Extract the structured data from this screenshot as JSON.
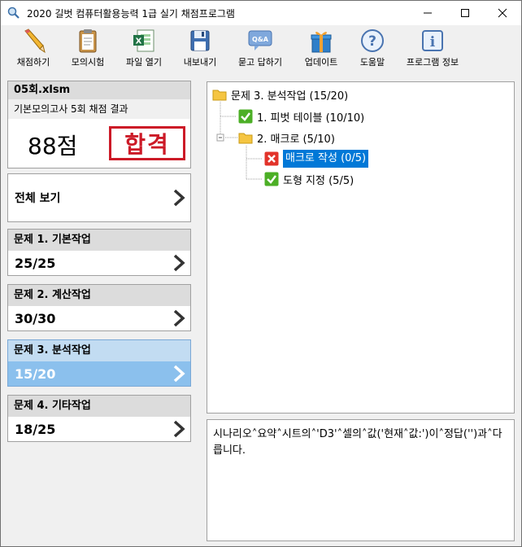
{
  "window": {
    "title": "2020 길벗 컴퓨터활용능력 1급 실기 채점프로그램"
  },
  "toolbar": [
    {
      "label": "채점하기",
      "icon": "pencil-icon"
    },
    {
      "label": "모의시험",
      "icon": "clipboard-icon"
    },
    {
      "label": "파일 열기",
      "icon": "excel-file-icon"
    },
    {
      "label": "내보내기",
      "icon": "floppy-disk-icon"
    },
    {
      "label": "묻고 답하기",
      "icon": "qa-bubble-icon"
    },
    {
      "label": "업데이트",
      "icon": "gift-icon"
    },
    {
      "label": "도움말",
      "icon": "question-icon"
    },
    {
      "label": "프로그램 정보",
      "icon": "info-icon"
    }
  ],
  "result": {
    "filename": "05회.xlsm",
    "subtitle": "기본모의고사 5회 채점 결과",
    "score": "88점",
    "stamp": "합격"
  },
  "view_all": {
    "label": "전체 보기"
  },
  "questions": [
    {
      "title": "문제 1. 기본작업",
      "score": "25/25",
      "active": false
    },
    {
      "title": "문제 2. 계산작업",
      "score": "30/30",
      "active": false
    },
    {
      "title": "문제 3. 분석작업",
      "score": "15/20",
      "active": true
    },
    {
      "title": "문제 4. 기타작업",
      "score": "18/25",
      "active": false
    }
  ],
  "tree": {
    "root": "문제 3. 분석작업 (15/20)",
    "item1": "1. 피벗 테이블 (10/10)",
    "item2": "2. 매크로 (5/10)",
    "item2_1": "매크로 작성 (0/5)",
    "item2_2": "도형 지정 (5/5)"
  },
  "message": "시나리오˄요약˄시트의˄'D3'˄셀의˄값('현재˄값:')이˄정답('')과˄다릅니다.",
  "colors": {
    "accent": "#0078d7",
    "active_card": "#8bc0ed",
    "stamp_red": "#cc1a27",
    "check_green": "#4caf26",
    "error_red": "#e2332a"
  }
}
